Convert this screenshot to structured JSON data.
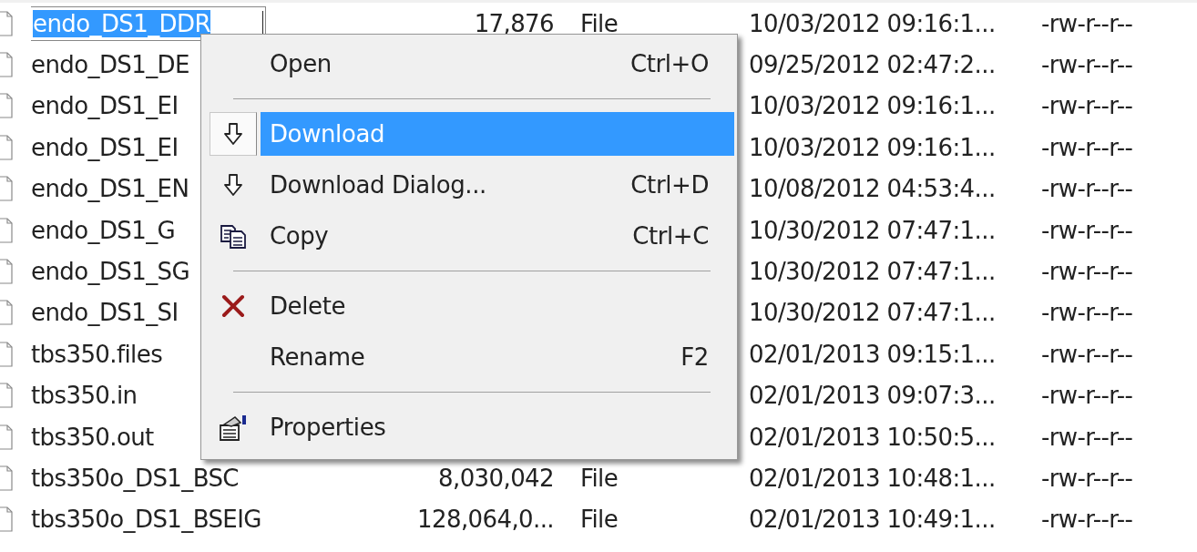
{
  "files": [
    {
      "name": "endo_DS1_DDR",
      "size": "17,876",
      "type": "File",
      "modified": "10/03/2012 09:16:1...",
      "permissions": "-rw-r--r--",
      "selected": true
    },
    {
      "name": "endo_DS1_DE",
      "modified": "09/25/2012 02:47:2...",
      "permissions": "-rw-r--r--",
      "selected": false
    },
    {
      "name": "endo_DS1_EI",
      "modified": "10/03/2012 09:16:1...",
      "permissions": "-rw-r--r--",
      "selected": false
    },
    {
      "name": "endo_DS1_EI",
      "modified": "10/03/2012 09:16:1...",
      "permissions": "-rw-r--r--",
      "selected": false
    },
    {
      "name": "endo_DS1_EN",
      "modified": "10/08/2012 04:53:4...",
      "permissions": "-rw-r--r--",
      "selected": false
    },
    {
      "name": "endo_DS1_G",
      "modified": "10/30/2012 07:47:1...",
      "permissions": "-rw-r--r--",
      "selected": false
    },
    {
      "name": "endo_DS1_SG",
      "modified": "10/30/2012 07:47:1...",
      "permissions": "-rw-r--r--",
      "selected": false
    },
    {
      "name": "endo_DS1_SI",
      "modified": "10/30/2012 07:47:1...",
      "permissions": "-rw-r--r--",
      "selected": false
    },
    {
      "name": "tbs350.files",
      "modified": "02/01/2013 09:15:1...",
      "permissions": "-rw-r--r--",
      "selected": false
    },
    {
      "name": "tbs350.in",
      "modified": "02/01/2013 09:07:3...",
      "permissions": "-rw-r--r--",
      "selected": false
    },
    {
      "name": "tbs350.out",
      "modified": "02/01/2013 10:50:5...",
      "permissions": "-rw-r--r--",
      "selected": false
    },
    {
      "name": "tbs350o_DS1_BSC",
      "size": "8,030,042",
      "type": "File",
      "modified": "02/01/2013 10:48:1...",
      "permissions": "-rw-r--r--",
      "selected": false
    },
    {
      "name": "tbs350o_DS1_BSEIG",
      "size": "128,064,0...",
      "type": "File",
      "modified": "02/01/2013 10:49:1...",
      "permissions": "-rw-r--r--",
      "selected": false
    }
  ],
  "context_menu": {
    "items": [
      {
        "kind": "plain",
        "label": "Open",
        "shortcut": "Ctrl+O",
        "selected": false
      },
      {
        "kind": "separator"
      },
      {
        "kind": "download",
        "label": "Download",
        "selected": true
      },
      {
        "kind": "download",
        "label": "Download Dialog...",
        "shortcut": "Ctrl+D",
        "selected": false
      },
      {
        "kind": "copy",
        "label": "Copy",
        "shortcut": "Ctrl+C",
        "selected": false
      },
      {
        "kind": "separator"
      },
      {
        "kind": "delete",
        "label": "Delete",
        "selected": false
      },
      {
        "kind": "plain",
        "label": "Rename",
        "shortcut": "F2",
        "selected": false
      },
      {
        "kind": "separator"
      },
      {
        "kind": "properties",
        "label": "Properties",
        "selected": false
      }
    ]
  }
}
